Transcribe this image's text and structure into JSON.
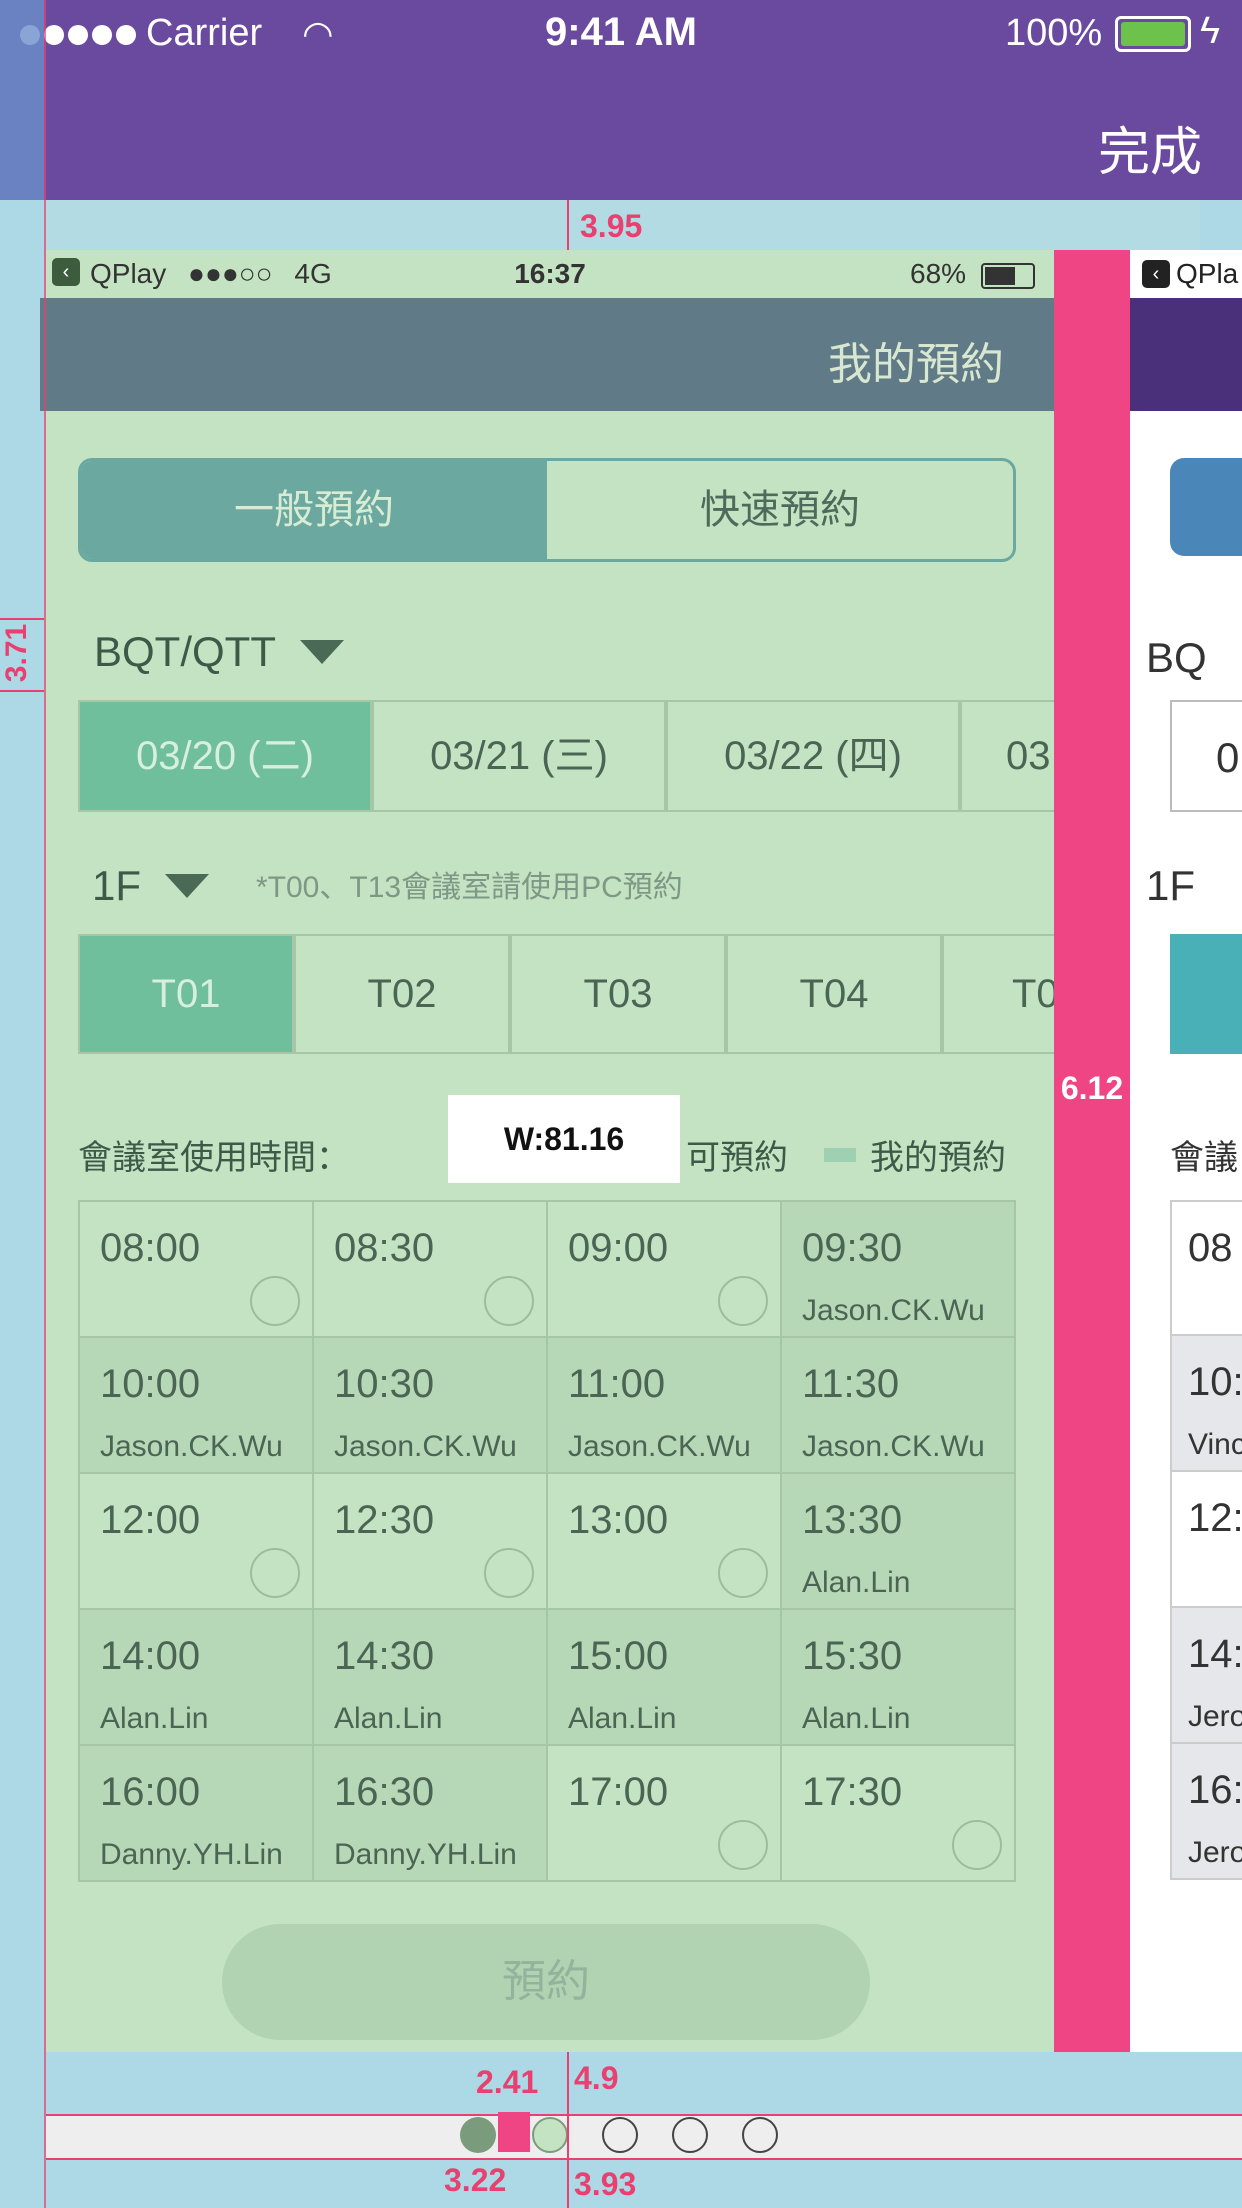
{
  "outer": {
    "carrier": "Carrier",
    "time": "9:41 AM",
    "battery": "100%",
    "done": "完成"
  },
  "phone": {
    "status": {
      "app": "QPlay",
      "signal": "●●●○○",
      "network": "4G",
      "time": "16:37",
      "battery": "68%"
    },
    "header_title": "我的預約",
    "tabs": [
      "一般預約",
      "快速預約"
    ],
    "site": "BQT/QTT",
    "dates": [
      "03/20 (二)",
      "03/21 (三)",
      "03/22 (四)",
      "03"
    ],
    "floor": "1F",
    "note": "*T00、T13會議室請使用PC預約",
    "rooms": [
      "T01",
      "T02",
      "T03",
      "T04",
      "T0"
    ],
    "usage_label": "會議室使用時間：",
    "width_tooltip": "W:81.16",
    "legend_available": "可預約",
    "legend_mine": "我的預約",
    "slots": [
      {
        "time": "08:00",
        "name": ""
      },
      {
        "time": "08:30",
        "name": ""
      },
      {
        "time": "09:00",
        "name": ""
      },
      {
        "time": "09:30",
        "name": "Jason.CK.Wu"
      },
      {
        "time": "10:00",
        "name": "Jason.CK.Wu"
      },
      {
        "time": "10:30",
        "name": "Jason.CK.Wu"
      },
      {
        "time": "11:00",
        "name": "Jason.CK.Wu"
      },
      {
        "time": "11:30",
        "name": "Jason.CK.Wu"
      },
      {
        "time": "12:00",
        "name": ""
      },
      {
        "time": "12:30",
        "name": ""
      },
      {
        "time": "13:00",
        "name": ""
      },
      {
        "time": "13:30",
        "name": "Alan.Lin"
      },
      {
        "time": "14:00",
        "name": "Alan.Lin"
      },
      {
        "time": "14:30",
        "name": "Alan.Lin"
      },
      {
        "time": "15:00",
        "name": "Alan.Lin"
      },
      {
        "time": "15:30",
        "name": "Alan.Lin"
      },
      {
        "time": "16:00",
        "name": "Danny.YH.Lin"
      },
      {
        "time": "16:30",
        "name": "Danny.YH.Lin"
      },
      {
        "time": "17:00",
        "name": ""
      },
      {
        "time": "17:30",
        "name": ""
      }
    ],
    "reserve_button": "預約"
  },
  "right_phone": {
    "app": "QPla",
    "site": "BQ",
    "date": "0",
    "floor": "1F",
    "usage": "會議",
    "slots": [
      {
        "time": "08",
        "name": ""
      },
      {
        "time": "10:",
        "name": "Vinc"
      },
      {
        "time": "12:",
        "name": ""
      },
      {
        "time": "14:",
        "name": "Jero"
      },
      {
        "time": "16:",
        "name": "Jero"
      }
    ]
  },
  "measurements": {
    "top_gap": "3.95",
    "left_gap": "3.71",
    "side_bar": "6.12",
    "dot_gap_top": "4.9",
    "dot_spacing": "2.41",
    "dot_size": "3.22",
    "dot_gap_bottom": "3.93"
  },
  "page_indicator": {
    "total": 5,
    "current": 1
  }
}
